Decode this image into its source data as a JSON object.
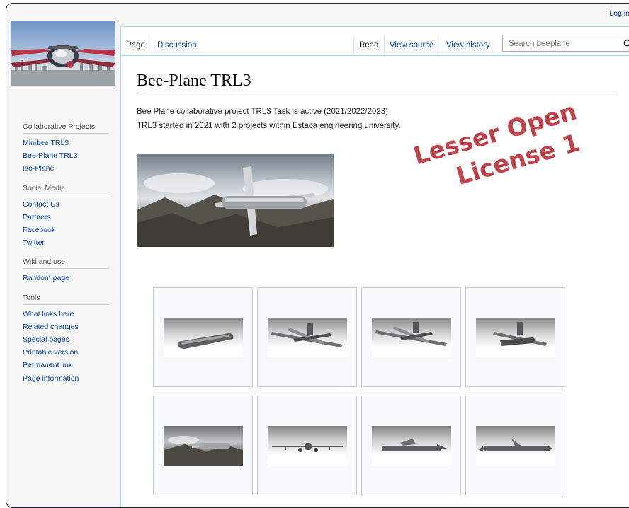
{
  "personal_tools": {
    "login": "Log in"
  },
  "sidebar": {
    "portals": [
      {
        "heading": "Collaborative Projects",
        "items": [
          "Minibee TRL3",
          "Bee-Plane TRL3",
          "Iso-Plane"
        ]
      },
      {
        "heading": "Social Media",
        "items": [
          "Contact Us",
          "Partners",
          "Facebook",
          "Twitter"
        ]
      },
      {
        "heading": "Wiki and use",
        "items": [
          "Random page"
        ]
      },
      {
        "heading": "Tools",
        "items": [
          "What links here",
          "Related changes",
          "Special pages",
          "Printable version",
          "Permanent link",
          "Page information"
        ]
      }
    ]
  },
  "tabs": {
    "page": "Page",
    "discussion": "Discussion",
    "read": "Read",
    "view_source": "View source",
    "view_history": "View history"
  },
  "search": {
    "placeholder": "Search beeplane",
    "icon": "magnifier-icon"
  },
  "page": {
    "title": "Bee-Plane TRL3",
    "paragraphs": [
      "Bee Plane collaborative project TRL3 Task is active (2021/2022/2023)",
      "TRL3 started in 2021 with 2 projects within Estaca engineering university."
    ]
  },
  "watermark": {
    "line1": "Lesser Open",
    "line2": "License 1"
  },
  "colors": {
    "link": "#0645ad",
    "watermark": "#b4202a",
    "tab_border": "#a7d7f9"
  }
}
